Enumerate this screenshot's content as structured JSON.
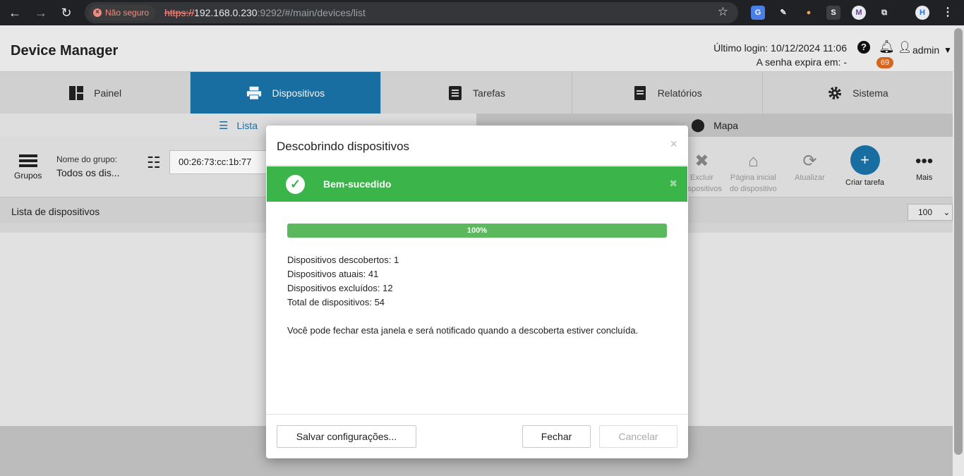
{
  "browser": {
    "insecure_label": "Não seguro",
    "url_protocol": "https://",
    "url_host": "192.168.0.230",
    "url_rest": ":9292/#/main/devices/list"
  },
  "header": {
    "app_title": "Device Manager",
    "last_login": "Último login: 10/12/2024 11:06",
    "password_expiry": "A senha expira em: -",
    "notification_count": "69",
    "user_name": "admin"
  },
  "main_nav": {
    "tabs": [
      {
        "label": "Painel"
      },
      {
        "label": "Dispositivos"
      },
      {
        "label": "Tarefas"
      },
      {
        "label": "Relatórios"
      },
      {
        "label": "Sistema"
      }
    ]
  },
  "sub_nav": {
    "list_label": "Lista",
    "map_label": "Mapa"
  },
  "toolbar": {
    "groups_label": "Grupos",
    "group_name_label": "Nome do grupo:",
    "group_name_value": "Todos os dis...",
    "search_value": "00:26:73:cc:1b:77",
    "delete_label_1": "Excluir",
    "delete_label_2": "dispositivos",
    "homepage_label_1": "Página inicial",
    "homepage_label_2": "do dispositivo",
    "refresh_label": "Atualizar",
    "create_task_label": "Criar tarefa",
    "more_label": "Mais"
  },
  "device_list": {
    "title": "Lista de dispositivos",
    "page_size": "100"
  },
  "modal": {
    "title": "Descobrindo dispositivos",
    "alert_text": "Bem-sucedido",
    "progress_label": "100%",
    "progress_value": 100,
    "stats": [
      "Dispositivos descobertos: 1",
      "Dispositivos atuais: 41",
      "Dispositivos excluídos: 12",
      "Total de dispositivos: 54"
    ],
    "notice": "Você pode fechar esta janela e será notificado quando a descoberta estiver concluída.",
    "save_button": "Salvar configurações...",
    "close_button": "Fechar",
    "cancel_button": "Cancelar"
  },
  "colors": {
    "accent": "#1b73a8",
    "success": "#3bb54a",
    "badge": "#e06a1f"
  }
}
